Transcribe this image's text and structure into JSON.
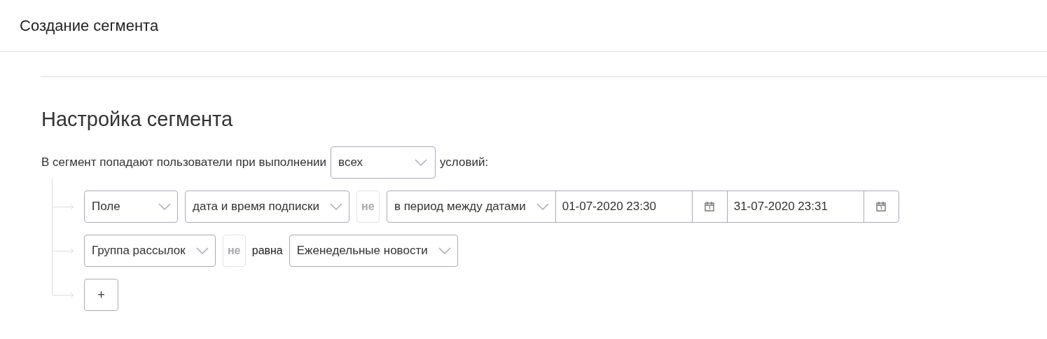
{
  "header": {
    "title": "Создание сегмента"
  },
  "section": {
    "title": "Настройка сегмента",
    "sentence_start": "В сегмент попадают пользователи при выполнении",
    "match_select": "всех",
    "sentence_end": "условий:"
  },
  "conditions": [
    {
      "parts": [
        {
          "kind": "select",
          "value": "Поле"
        },
        {
          "kind": "select",
          "value": "дата и время подписки"
        },
        {
          "kind": "toggle",
          "label": "не",
          "selected": false
        },
        {
          "kind": "select",
          "value": "в период между датами"
        },
        {
          "kind": "date",
          "value": "01-07-2020 23:30"
        },
        {
          "kind": "date",
          "value": "31-07-2020 23:31"
        }
      ]
    },
    {
      "parts": [
        {
          "kind": "select",
          "value": "Группа рассылок"
        },
        {
          "kind": "toggle",
          "label": "не",
          "selected": false
        },
        {
          "kind": "label",
          "text": "равна"
        },
        {
          "kind": "select",
          "value": "Еженедельные новости"
        }
      ]
    }
  ],
  "add_button": "+"
}
